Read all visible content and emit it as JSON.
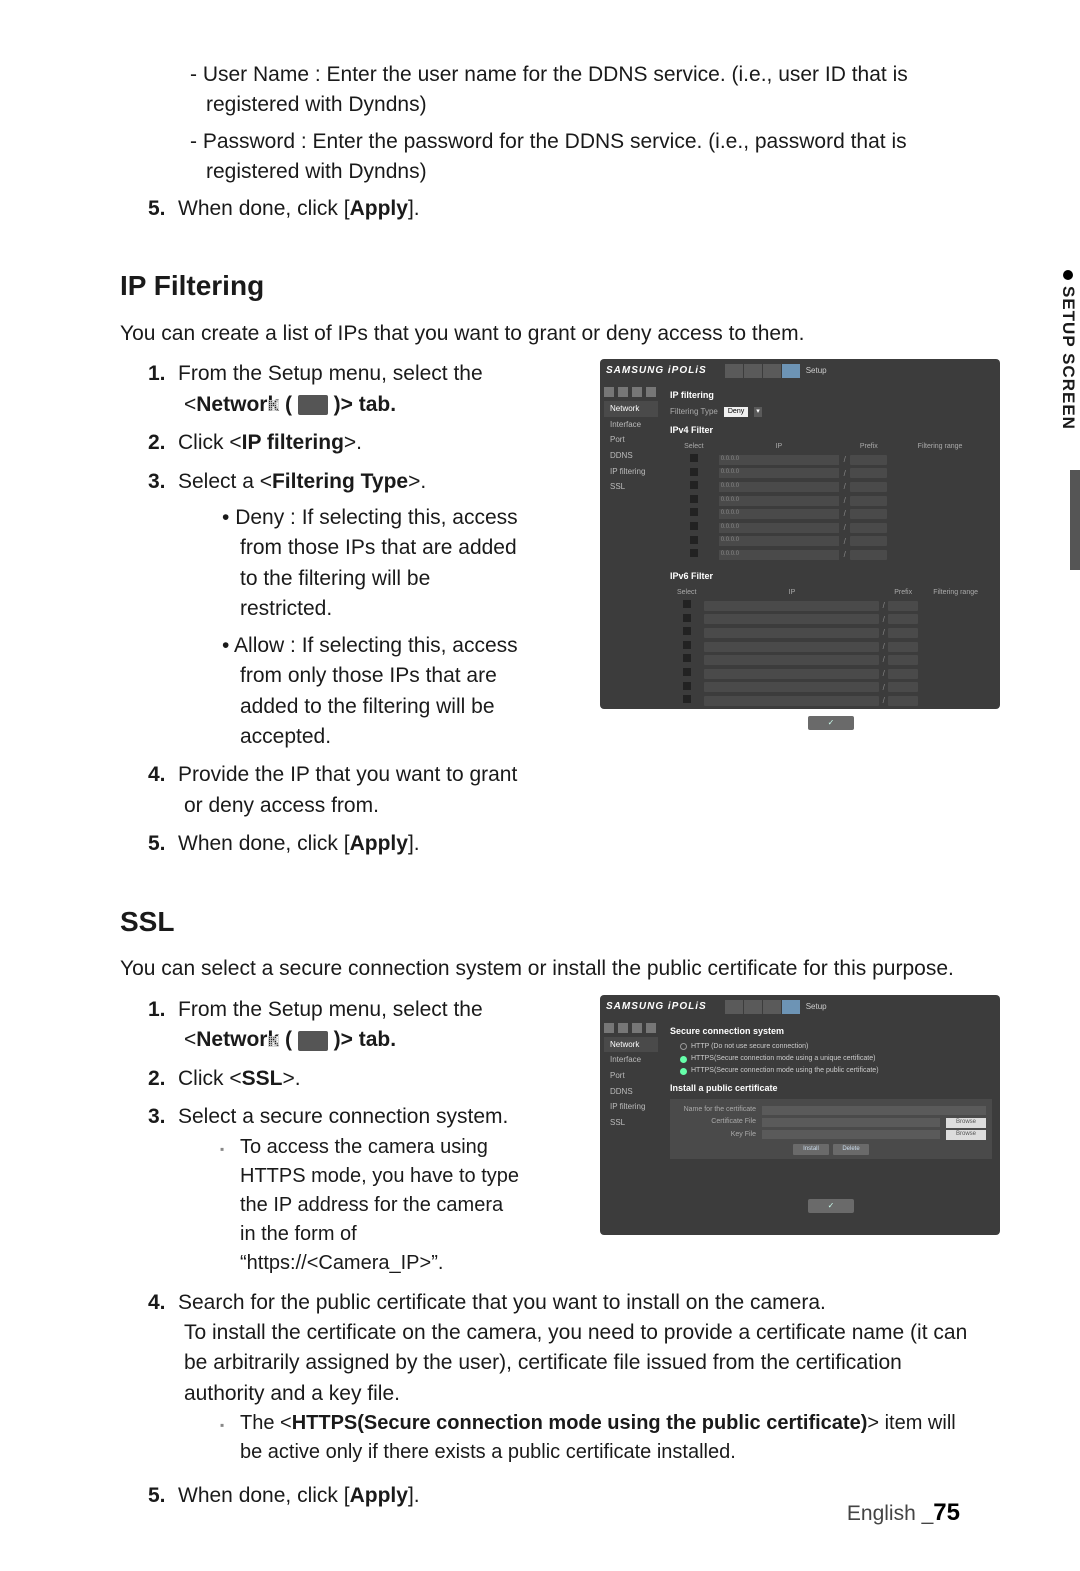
{
  "top_dashes": [
    "User Name : Enter the user name for the DDNS service. (i.e., user ID that is registered with Dyndns)",
    "Password : Enter the password for the DDNS service. (i.e., password that is registered with Dyndns)"
  ],
  "top_step5_pre": "When done, click [",
  "top_step5_bold": "Apply",
  "top_step5_post": "].",
  "sections": {
    "ipfiltering": {
      "heading": "IP Filtering",
      "intro": "You can create a list of IPs that you want to grant or deny access to them.",
      "steps": {
        "s1_pre": "From the Setup menu, select the <",
        "s1_bold": "Network (",
        "s1_post": ")> tab.",
        "s2_pre": "Click <",
        "s2_bold": "IP filtering",
        "s2_post": ">.",
        "s3_pre": "Select a <",
        "s3_bold": "Filtering Type",
        "s3_post": ">.",
        "s3_bullets": [
          "Deny : If selecting this, access from those IPs that are added to the filtering will be restricted.",
          "Allow : If selecting this, access from only those IPs that are added to the filtering will be accepted."
        ],
        "s4": "Provide the IP that you want to grant or deny access from.",
        "s5_pre": "When done, click [",
        "s5_bold": "Apply",
        "s5_post": "]."
      }
    },
    "ssl": {
      "heading": "SSL",
      "intro": "You can select a secure connection system or install the public certificate for this purpose.",
      "steps": {
        "s1_pre": "From the Setup menu, select the <",
        "s1_bold": "Network (",
        "s1_post": ")> tab.",
        "s2_pre": "Click <",
        "s2_bold": "SSL",
        "s2_post": ">.",
        "s3": "Select a secure connection system.",
        "s3_note": "To access the camera using HTTPS mode, you have to type the IP address for the camera in the form of “https://<Camera_IP>”.",
        "s4": "Search for the public certificate that you want to install on the camera.\nTo install the certificate on the camera, you need to provide a certificate name (it can be arbitrarily assigned by the user), certificate file issued from the certification authority and a key file.",
        "s4_note_pre": "The <",
        "s4_note_bold": "HTTPS(Secure connection mode using the public certificate)",
        "s4_note_post": "> item will be active only if there exists a public certificate installed.",
        "s5_pre": "When done, click [",
        "s5_bold": "Apply",
        "s5_post": "]."
      }
    }
  },
  "figure1": {
    "logo": "SAMSUNG iPOLiS",
    "setup": "Setup",
    "sidebar_highlight": "Network",
    "sidebar_items": [
      "Interface",
      "Port",
      "DDNS",
      "IP filtering",
      "SSL"
    ],
    "section1": "IP filtering",
    "filtering_type_label": "Filtering Type",
    "filtering_type_value": "Deny",
    "block_ipv4": "IPv4 Filter",
    "block_ipv6": "IPv6 Filter",
    "cols": [
      "Select",
      "IP",
      "Prefix",
      "Filtering range"
    ],
    "ok": "✓"
  },
  "figure2": {
    "logo": "SAMSUNG iPOLiS",
    "setup": "Setup",
    "sidebar_highlight": "Network",
    "sidebar_items": [
      "Interface",
      "Port",
      "DDNS",
      "IP filtering",
      "SSL"
    ],
    "section1": "Secure connection system",
    "radios": [
      "HTTP (Do not use secure connection)",
      "HTTPS(Secure connection mode using a unique certificate)",
      "HTTPS(Secure connection mode using the public certificate)"
    ],
    "section2": "Install a public certificate",
    "cert_rows": [
      "Name for the certificate",
      "Certificate File",
      "Key File"
    ],
    "browse": "Browse",
    "install": "Install",
    "delete": "Delete",
    "ok": "✓"
  },
  "sidetab": "SETUP SCREEN",
  "footer_lang": "English _",
  "footer_page": "75"
}
